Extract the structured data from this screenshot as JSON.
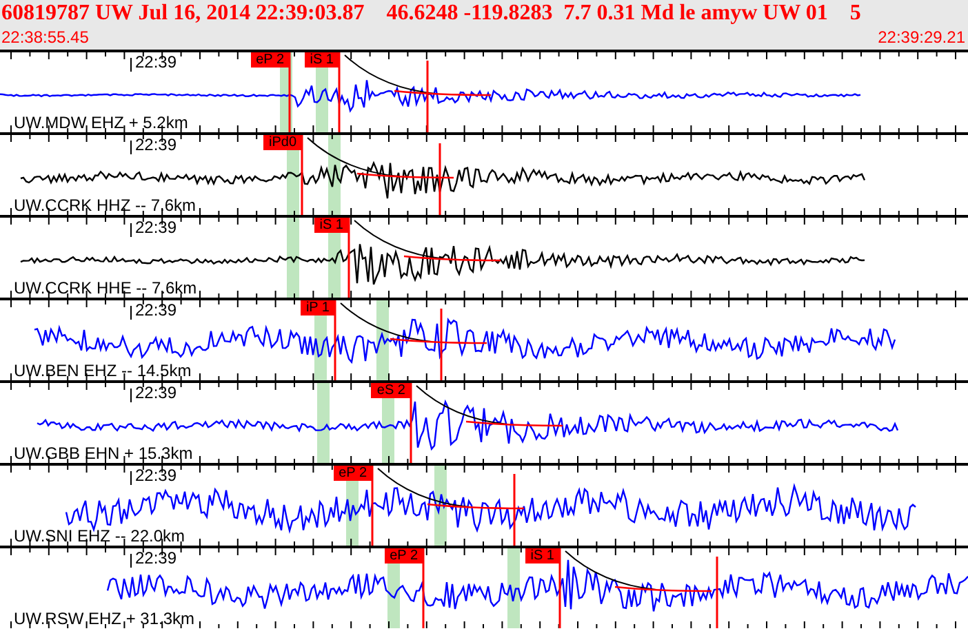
{
  "header": {
    "title": "60819787 UW Jul 16, 2014 22:39:03.87    46.6248 -119.8283  7.7 0.31 Md le amyw UW 01    5",
    "start_time": "22:38:55.45",
    "end_time": "22:39:29.21"
  },
  "traces": [
    {
      "station": "UW.MDW EHZ + 5.2km",
      "time_label": "22:39",
      "color": "#0000ff",
      "picks": [
        {
          "label": "eP 2"
        },
        {
          "label": "iS 1"
        }
      ]
    },
    {
      "station": "UW.CCRK HHZ -- 7.6km",
      "time_label": "22:39",
      "color": "#000000",
      "picks": [
        {
          "label": "iPd0"
        }
      ]
    },
    {
      "station": "UW.CCRK HHE -- 7.6km",
      "time_label": "22:39",
      "color": "#000000",
      "picks": [
        {
          "label": "iS 1"
        }
      ]
    },
    {
      "station": "UW.BEN EHZ -- 14.5km",
      "time_label": "22:39",
      "color": "#0000ff",
      "picks": [
        {
          "label": "iP 1"
        }
      ]
    },
    {
      "station": "UW.GBB EHN + 15.3km",
      "time_label": "22:39",
      "color": "#0000ff",
      "picks": [
        {
          "label": "eS 2"
        }
      ]
    },
    {
      "station": "UW.SNI EHZ -- 22.0km",
      "time_label": "22:39",
      "color": "#0000ff",
      "picks": [
        {
          "label": "eP 2"
        }
      ]
    },
    {
      "station": "UW.RSW EHZ + 31.3km",
      "time_label": "22:39",
      "color": "#0000ff",
      "picks": [
        {
          "label": "eP 2"
        },
        {
          "label": "iS 1"
        }
      ]
    }
  ]
}
